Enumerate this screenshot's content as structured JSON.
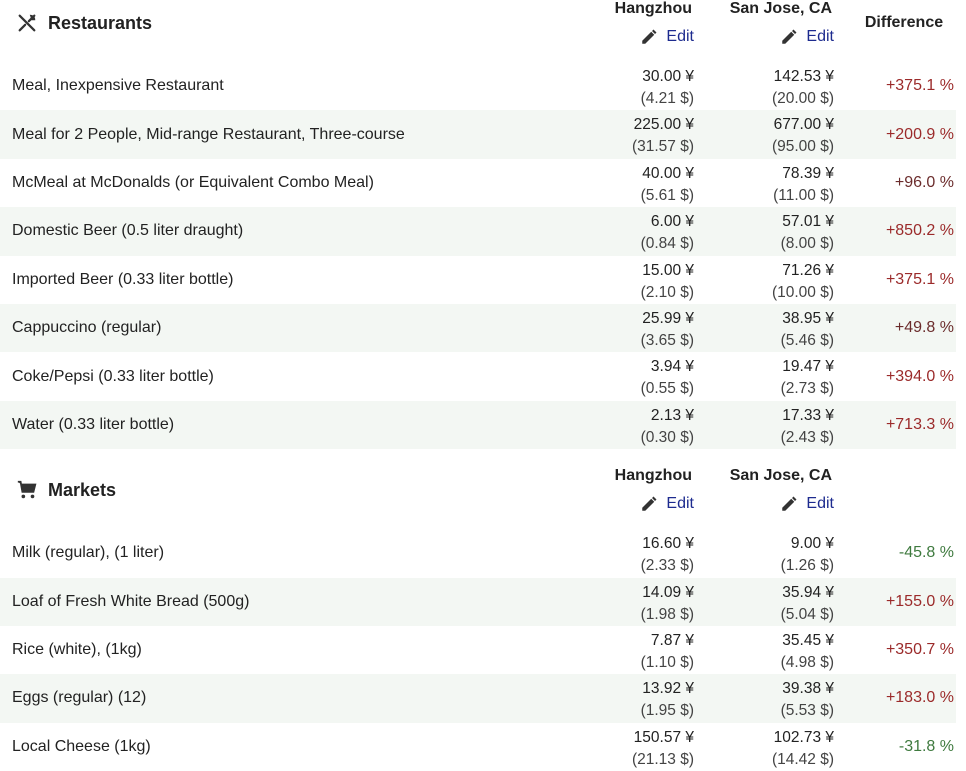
{
  "columns": {
    "city1": "Hangzhou",
    "city2": "San Jose, CA",
    "difference": "Difference",
    "edit_label": "Edit"
  },
  "colors": {
    "positive_high": "#9b2a2a",
    "positive_mid": "#6b2c2c",
    "negative": "#3f7a3f",
    "link": "#1d2b8f",
    "row_alt": "#f3f7f3"
  },
  "restaurants": {
    "title": "Restaurants",
    "icon": "fork-knife-icon",
    "rows": [
      {
        "item": "Meal, Inexpensive Restaurant",
        "c1": "30.00 ¥",
        "c1usd": "(4.21 $)",
        "c2": "142.53 ¥",
        "c2usd": "(20.00 $)",
        "diff": "+375.1 %"
      },
      {
        "item": "Meal for 2 People, Mid-range Restaurant, Three-course",
        "c1": "225.00 ¥",
        "c1usd": "(31.57 $)",
        "c2": "677.00 ¥",
        "c2usd": "(95.00 $)",
        "diff": "+200.9 %"
      },
      {
        "item": "McMeal at McDonalds (or Equivalent Combo Meal)",
        "c1": "40.00 ¥",
        "c1usd": "(5.61 $)",
        "c2": "78.39 ¥",
        "c2usd": "(11.00 $)",
        "diff": "+96.0 %"
      },
      {
        "item": "Domestic Beer (0.5 liter draught)",
        "c1": "6.00 ¥",
        "c1usd": "(0.84 $)",
        "c2": "57.01 ¥",
        "c2usd": "(8.00 $)",
        "diff": "+850.2 %"
      },
      {
        "item": "Imported Beer (0.33 liter bottle)",
        "c1": "15.00 ¥",
        "c1usd": "(2.10 $)",
        "c2": "71.26 ¥",
        "c2usd": "(10.00 $)",
        "diff": "+375.1 %"
      },
      {
        "item": "Cappuccino (regular)",
        "c1": "25.99 ¥",
        "c1usd": "(3.65 $)",
        "c2": "38.95 ¥",
        "c2usd": "(5.46 $)",
        "diff": "+49.8 %"
      },
      {
        "item": "Coke/Pepsi (0.33 liter bottle)",
        "c1": "3.94 ¥",
        "c1usd": "(0.55 $)",
        "c2": "19.47 ¥",
        "c2usd": "(2.73 $)",
        "diff": "+394.0 %"
      },
      {
        "item": "Water (0.33 liter bottle)",
        "c1": "2.13 ¥",
        "c1usd": "(0.30 $)",
        "c2": "17.33 ¥",
        "c2usd": "(2.43 $)",
        "diff": "+713.3 %"
      }
    ]
  },
  "markets": {
    "title": "Markets",
    "icon": "shopping-cart-icon",
    "rows": [
      {
        "item": "Milk (regular), (1 liter)",
        "c1": "16.60 ¥",
        "c1usd": "(2.33 $)",
        "c2": "9.00 ¥",
        "c2usd": "(1.26 $)",
        "diff": "-45.8 %"
      },
      {
        "item": "Loaf of Fresh White Bread (500g)",
        "c1": "14.09 ¥",
        "c1usd": "(1.98 $)",
        "c2": "35.94 ¥",
        "c2usd": "(5.04 $)",
        "diff": "+155.0 %"
      },
      {
        "item": "Rice (white), (1kg)",
        "c1": "7.87 ¥",
        "c1usd": "(1.10 $)",
        "c2": "35.45 ¥",
        "c2usd": "(4.98 $)",
        "diff": "+350.7 %"
      },
      {
        "item": "Eggs (regular) (12)",
        "c1": "13.92 ¥",
        "c1usd": "(1.95 $)",
        "c2": "39.38 ¥",
        "c2usd": "(5.53 $)",
        "diff": "+183.0 %"
      },
      {
        "item": "Local Cheese (1kg)",
        "c1": "150.57 ¥",
        "c1usd": "(21.13 $)",
        "c2": "102.73 ¥",
        "c2usd": "(14.42 $)",
        "diff": "-31.8 %"
      }
    ]
  }
}
